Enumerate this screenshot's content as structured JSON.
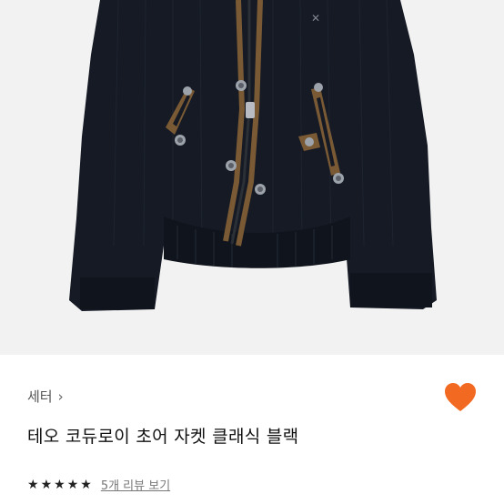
{
  "product": {
    "brand": "세터",
    "brand_chevron": "›",
    "title": "테오 코듀로이 초어 자켓 클래식 블랙",
    "rating_stars": 5,
    "review_link": "5개 리뷰 보기"
  },
  "icons": {
    "wishlist": "heart-icon",
    "brand_arrow": "chevron-right-icon",
    "star": "star-icon"
  },
  "colors": {
    "accent": "#f26a21",
    "jacket": "#151a24",
    "trim": "#7a5a35",
    "image_bg": "#f2f2f2"
  }
}
